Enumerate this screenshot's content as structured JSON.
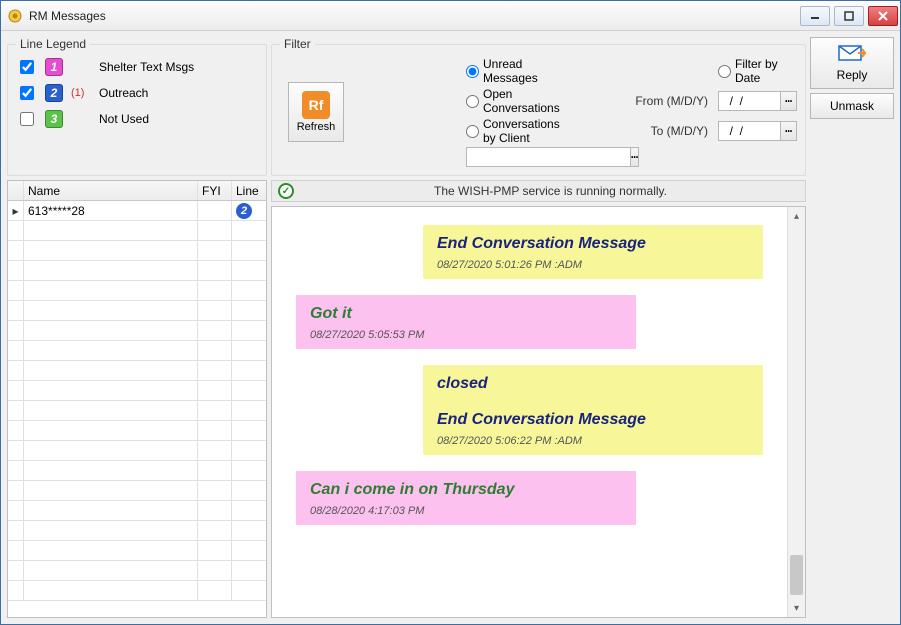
{
  "window": {
    "title": "RM Messages"
  },
  "legend": {
    "title": "Line Legend",
    "lines": [
      {
        "num": "1",
        "checked": true,
        "count": "",
        "label": "Shelter Text Msgs",
        "color": "#e64bd0"
      },
      {
        "num": "2",
        "checked": true,
        "count": "(1)",
        "label": "Outreach",
        "color": "#2a5fd0"
      },
      {
        "num": "3",
        "checked": false,
        "count": "",
        "label": "Not Used",
        "color": "#5bc24a"
      }
    ]
  },
  "filter": {
    "title": "Filter",
    "radios": {
      "unread": "Unread Messages",
      "open": "Open Conversations",
      "by_client": "Conversations by Client",
      "by_date": "Filter by Date"
    },
    "selected": "unread",
    "from_label": "From (M/D/Y)",
    "to_label": "To (M/D/Y)",
    "from_value": "  /  /",
    "to_value": "  /  /",
    "client_value": "",
    "refresh_label": "Refresh",
    "refresh_icon_text": "Rf"
  },
  "actions": {
    "reply": "Reply",
    "unmask": "Unmask"
  },
  "status": {
    "text": "The WISH-PMP service is running normally."
  },
  "grid": {
    "headers": {
      "name": "Name",
      "fyi": "FYI",
      "line": "Line"
    },
    "rows": [
      {
        "current": true,
        "name": "613*****28",
        "fyi": "",
        "line_num": "2",
        "line_color": "#2a5fd0"
      }
    ],
    "blank_rows": 19
  },
  "conversation": [
    {
      "side": "right",
      "text": "End Conversation Message",
      "ts": "08/27/2020 5:01:26 PM :ADM"
    },
    {
      "side": "left",
      "text": "Got it",
      "ts": "08/27/2020 5:05:53 PM"
    },
    {
      "side": "right",
      "text": "closed\n\nEnd Conversation Message",
      "ts": "08/27/2020 5:06:22 PM :ADM"
    },
    {
      "side": "left",
      "text": "Can i come in on Thursday",
      "ts": "08/28/2020 4:17:03 PM"
    }
  ]
}
